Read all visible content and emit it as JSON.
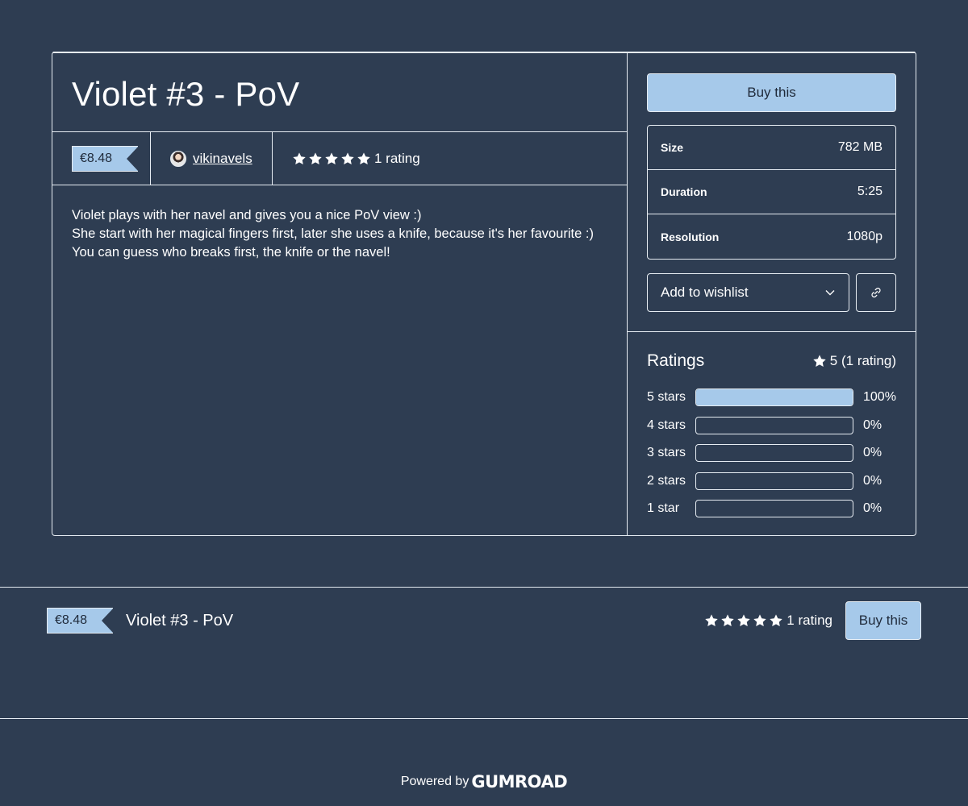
{
  "product": {
    "title": "Violet #3 - PoV",
    "price": "€8.48",
    "creator": "vikinavels",
    "rating_text": "1 rating",
    "star_count": 5,
    "description": [
      "Violet plays with her navel and gives you a nice PoV view :)",
      "She start with her magical fingers first, later she uses a knife, because it's her favourite :)",
      "You can guess who breaks first, the knife or the navel!"
    ]
  },
  "sidebar": {
    "buy_label": "Buy this",
    "info": [
      {
        "label": "Size",
        "value": "782 MB"
      },
      {
        "label": "Duration",
        "value": "5:25"
      },
      {
        "label": "Resolution",
        "value": "1080p"
      }
    ],
    "wishlist_label": "Add to wishlist"
  },
  "ratings": {
    "title": "Ratings",
    "summary": "5 (1 rating)",
    "rows": [
      {
        "label": "5 stars",
        "percent": "100%",
        "fraction": 1.0
      },
      {
        "label": "4 stars",
        "percent": "0%",
        "fraction": 0
      },
      {
        "label": "3 stars",
        "percent": "0%",
        "fraction": 0
      },
      {
        "label": "2 stars",
        "percent": "0%",
        "fraction": 0
      },
      {
        "label": "1 star",
        "percent": "0%",
        "fraction": 0
      }
    ]
  },
  "sticky_bar": {
    "price": "€8.48",
    "title": "Violet #3 - PoV",
    "rating_text": "1 rating",
    "buy_label": "Buy this"
  },
  "footer": {
    "powered_by": "Powered by",
    "brand": "Gumroad"
  },
  "colors": {
    "background": "#2e3d52",
    "accent": "#a6c9ea",
    "border": "#e6ecf2"
  }
}
